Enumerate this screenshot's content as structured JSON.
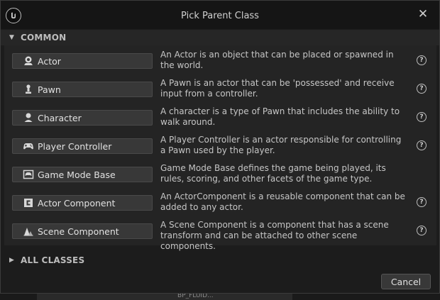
{
  "dialog": {
    "title": "Pick Parent Class",
    "close_icon": "close-icon",
    "logo_icon": "unreal-logo-icon"
  },
  "sections": {
    "common_label": "COMMON",
    "all_classes_label": "ALL CLASSES"
  },
  "classes": [
    {
      "label": "Actor",
      "icon": "actor-icon",
      "description": "An Actor is an object that can be placed or spawned in the world.",
      "has_help": true
    },
    {
      "label": "Pawn",
      "icon": "pawn-icon",
      "description": "A Pawn is an actor that can be 'possessed' and receive input from a controller.",
      "has_help": true
    },
    {
      "label": "Character",
      "icon": "character-icon",
      "description": "A character is a type of Pawn that includes the ability to walk around.",
      "has_help": true
    },
    {
      "label": "Player Controller",
      "icon": "gamepad-icon",
      "description": "A Player Controller is an actor responsible for controlling a Pawn used by the player.",
      "has_help": true
    },
    {
      "label": "Game Mode Base",
      "icon": "game-mode-icon",
      "description": "Game Mode Base defines the game being played, its rules, scoring, and other facets of the game type.",
      "has_help": false
    },
    {
      "label": "Actor Component",
      "icon": "actor-component-icon",
      "description": "An ActorComponent is a reusable component that can be added to any actor.",
      "has_help": true
    },
    {
      "label": "Scene Component",
      "icon": "scene-component-icon",
      "description": "A Scene Component is a component that has a scene transform and can be attached to other scene components.",
      "has_help": true
    }
  ],
  "help_glyph": "?",
  "footer": {
    "cancel_label": "Cancel"
  },
  "background": {
    "partial_text": "BP_FLUID..."
  }
}
